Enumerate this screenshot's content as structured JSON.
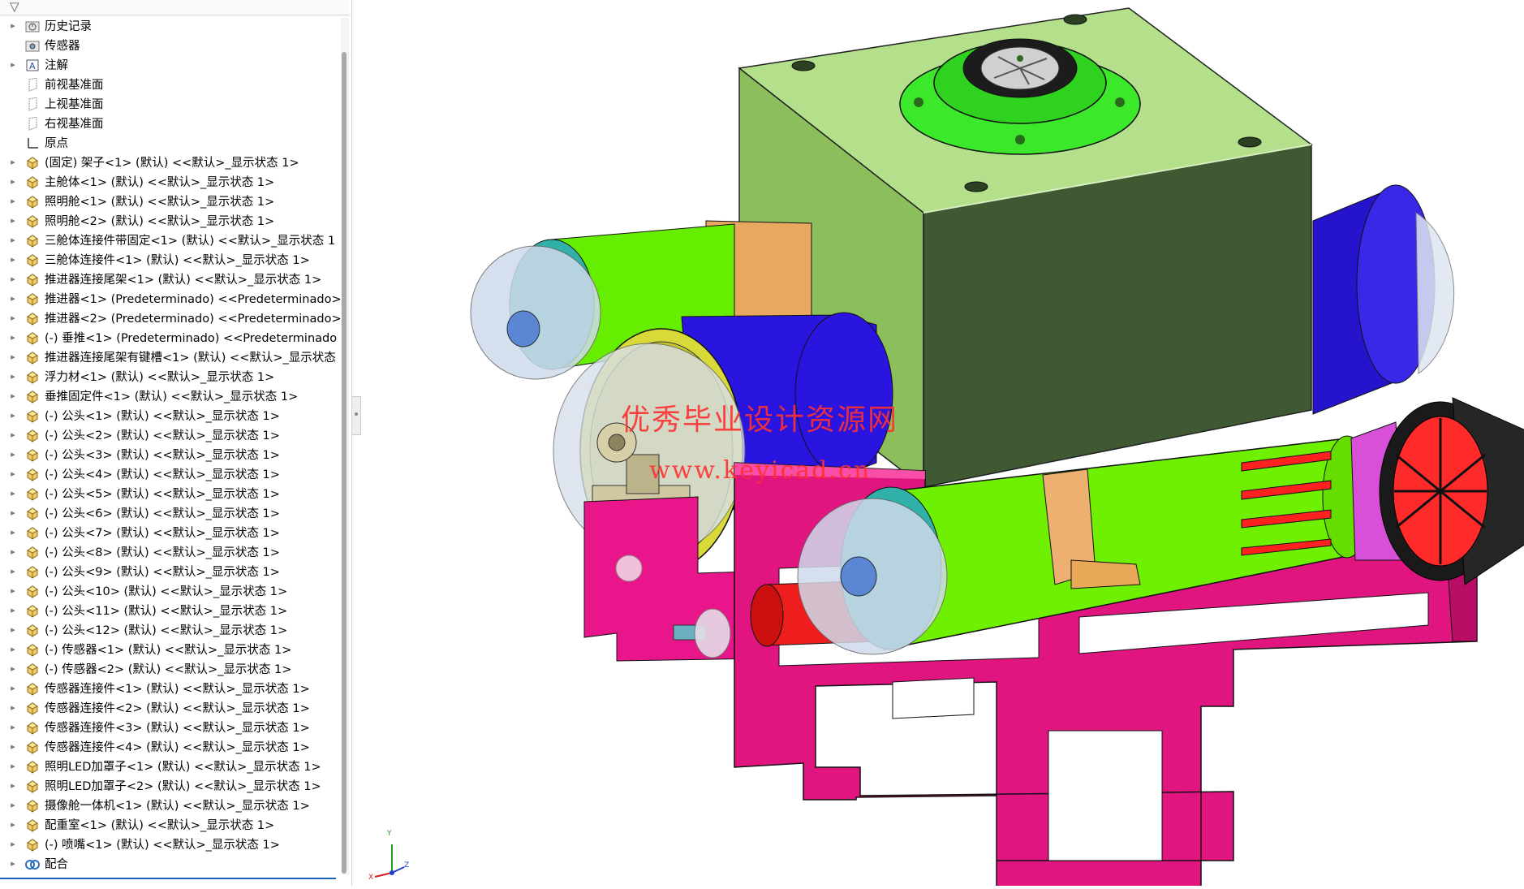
{
  "feature_tree": {
    "items": [
      {
        "label": "历史记录",
        "icon": "history-folder-icon",
        "expandable": true
      },
      {
        "label": "传感器",
        "icon": "sensor-folder-icon",
        "expandable": false
      },
      {
        "label": "注解",
        "icon": "annotation-icon",
        "expandable": true
      },
      {
        "label": "前视基准面",
        "icon": "plane-icon",
        "expandable": false
      },
      {
        "label": "上视基准面",
        "icon": "plane-icon",
        "expandable": false
      },
      {
        "label": "右视基准面",
        "icon": "plane-icon",
        "expandable": false
      },
      {
        "label": "原点",
        "icon": "origin-icon",
        "expandable": false
      },
      {
        "label": "(固定) 架子<1> (默认) <<默认>_显示状态 1>",
        "icon": "part-icon",
        "expandable": true
      },
      {
        "label": "主舱体<1> (默认) <<默认>_显示状态 1>",
        "icon": "part-icon",
        "expandable": true
      },
      {
        "label": "照明舱<1> (默认) <<默认>_显示状态 1>",
        "icon": "part-icon",
        "expandable": true
      },
      {
        "label": "照明舱<2> (默认) <<默认>_显示状态 1>",
        "icon": "part-icon",
        "expandable": true
      },
      {
        "label": "三舱体连接件带固定<1> (默认) <<默认>_显示状态 1",
        "icon": "part-icon",
        "expandable": true
      },
      {
        "label": "三舱体连接件<1> (默认) <<默认>_显示状态 1>",
        "icon": "part-icon",
        "expandable": true
      },
      {
        "label": "推进器连接尾架<1> (默认) <<默认>_显示状态 1>",
        "icon": "part-icon",
        "expandable": true
      },
      {
        "label": "推进器<1> (Predeterminado) <<Predeterminado>",
        "icon": "part-icon",
        "expandable": true
      },
      {
        "label": "推进器<2> (Predeterminado) <<Predeterminado>",
        "icon": "part-icon",
        "expandable": true
      },
      {
        "label": "(-) 垂推<1> (Predeterminado) <<Predeterminado",
        "icon": "part-icon",
        "expandable": true
      },
      {
        "label": "推进器连接尾架有键槽<1> (默认) <<默认>_显示状态",
        "icon": "part-icon",
        "expandable": true
      },
      {
        "label": "浮力材<1> (默认) <<默认>_显示状态 1>",
        "icon": "part-icon",
        "expandable": true
      },
      {
        "label": "垂推固定件<1> (默认) <<默认>_显示状态 1>",
        "icon": "part-icon",
        "expandable": true
      },
      {
        "label": "(-) 公头<1> (默认) <<默认>_显示状态 1>",
        "icon": "part-icon",
        "expandable": true
      },
      {
        "label": "(-) 公头<2> (默认) <<默认>_显示状态 1>",
        "icon": "part-icon",
        "expandable": true
      },
      {
        "label": "(-) 公头<3> (默认) <<默认>_显示状态 1>",
        "icon": "part-icon",
        "expandable": true
      },
      {
        "label": "(-) 公头<4> (默认) <<默认>_显示状态 1>",
        "icon": "part-icon",
        "expandable": true
      },
      {
        "label": "(-) 公头<5> (默认) <<默认>_显示状态 1>",
        "icon": "part-icon",
        "expandable": true
      },
      {
        "label": "(-) 公头<6> (默认) <<默认>_显示状态 1>",
        "icon": "part-icon",
        "expandable": true
      },
      {
        "label": "(-) 公头<7> (默认) <<默认>_显示状态 1>",
        "icon": "part-icon",
        "expandable": true
      },
      {
        "label": "(-) 公头<8> (默认) <<默认>_显示状态 1>",
        "icon": "part-icon",
        "expandable": true
      },
      {
        "label": "(-) 公头<9> (默认) <<默认>_显示状态 1>",
        "icon": "part-icon",
        "expandable": true
      },
      {
        "label": "(-) 公头<10> (默认) <<默认>_显示状态 1>",
        "icon": "part-icon",
        "expandable": true
      },
      {
        "label": "(-) 公头<11> (默认) <<默认>_显示状态 1>",
        "icon": "part-icon",
        "expandable": true
      },
      {
        "label": "(-) 公头<12> (默认) <<默认>_显示状态 1>",
        "icon": "part-icon",
        "expandable": true
      },
      {
        "label": "(-) 传感器<1> (默认) <<默认>_显示状态 1>",
        "icon": "part-icon",
        "expandable": true
      },
      {
        "label": "(-) 传感器<2> (默认) <<默认>_显示状态 1>",
        "icon": "part-icon",
        "expandable": true
      },
      {
        "label": "传感器连接件<1> (默认) <<默认>_显示状态 1>",
        "icon": "part-icon",
        "expandable": true
      },
      {
        "label": "传感器连接件<2> (默认) <<默认>_显示状态 1>",
        "icon": "part-icon",
        "expandable": true
      },
      {
        "label": "传感器连接件<3> (默认) <<默认>_显示状态 1>",
        "icon": "part-icon",
        "expandable": true
      },
      {
        "label": "传感器连接件<4> (默认) <<默认>_显示状态 1>",
        "icon": "part-icon",
        "expandable": true
      },
      {
        "label": "照明LED加罩子<1> (默认) <<默认>_显示状态 1>",
        "icon": "part-icon",
        "expandable": true
      },
      {
        "label": "照明LED加罩子<2> (默认) <<默认>_显示状态 1>",
        "icon": "part-icon",
        "expandable": true
      },
      {
        "label": "摄像舱一体机<1> (默认) <<默认>_显示状态 1>",
        "icon": "part-icon",
        "expandable": true
      },
      {
        "label": "配重室<1> (默认) <<默认>_显示状态 1>",
        "icon": "part-icon",
        "expandable": true
      },
      {
        "label": "(-) 喷嘴<1> (默认) <<默认>_显示状态 1>",
        "icon": "part-icon",
        "expandable": true
      },
      {
        "label": "配合",
        "icon": "mates-icon",
        "expandable": true
      }
    ]
  },
  "viewport": {
    "watermark_line1": "优秀毕业设计资源网",
    "watermark_line2": "www.keyicad.cn",
    "triad_labels": {
      "y": "Y",
      "x": "X",
      "z": "Z"
    }
  },
  "colors": {
    "frame": "#e0157a",
    "main_hull": "#9ed46b",
    "cylinder_green": "#7ef000",
    "cylinder_blue": "#2a14e0",
    "flange_yellow": "#d9d93a",
    "clamp_orange": "#f0b070",
    "thruster_red": "#ff2020",
    "dome_glass": "#c9d9ee"
  }
}
